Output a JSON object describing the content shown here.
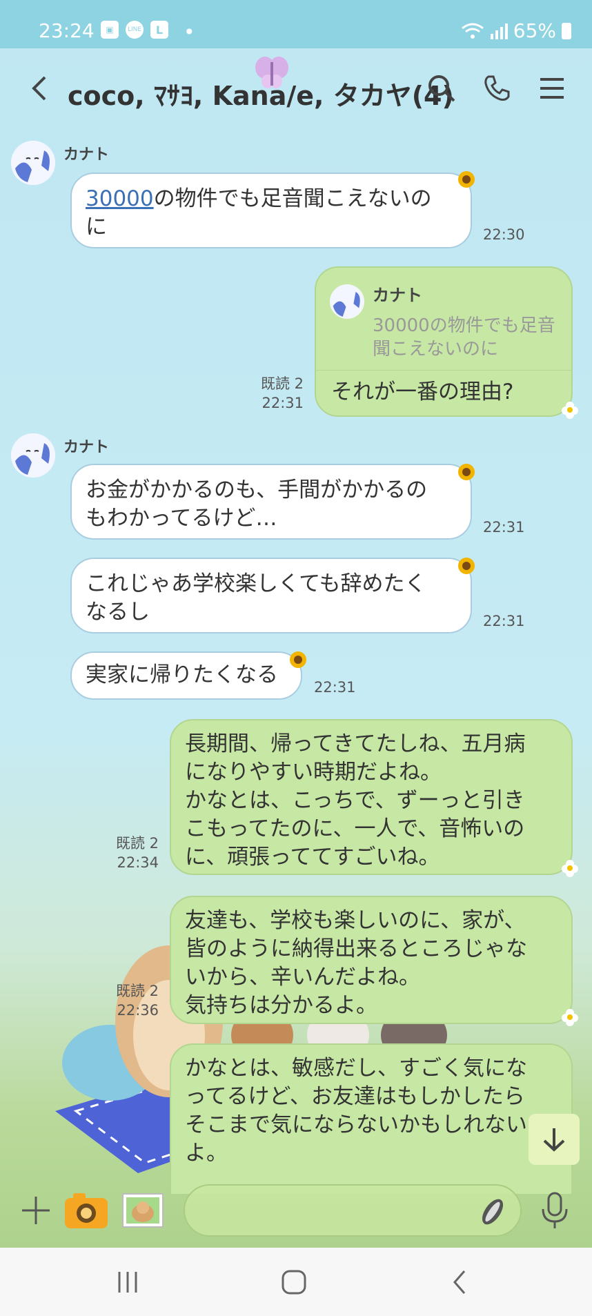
{
  "status": {
    "time": "23:24",
    "battery": "65%",
    "line_icon": "LINE",
    "l_icon": "L"
  },
  "header": {
    "title": "coco, ﾏｻﾖ, Kana/e, タカヤ(4)"
  },
  "messages": [
    {
      "sender": "カナト",
      "link": "30000",
      "text_rest": "の物件でも足音聞こえないの",
      "text2": "に",
      "time": "22:30"
    },
    {
      "quote_name": "カナト",
      "quote_line1": "30000の物件でも足音",
      "quote_line2": "聞こえないのに",
      "text": "それが一番の理由?",
      "read": "既読 2",
      "time": "22:31"
    },
    {
      "sender": "カナト",
      "line1": "お金がかかるのも、手間がかかるの",
      "line2": "もわかってるけど…",
      "time": "22:31"
    },
    {
      "line1": "これじゃあ学校楽しくても辞めたく",
      "line2": "なるし",
      "time": "22:31"
    },
    {
      "text": "実家に帰りたくなる",
      "time": "22:31"
    },
    {
      "lines": [
        "長期間、帰ってきてたしね、五月病",
        "になりやすい時期だよね。",
        "かなとは、こっちで、ずーっと引き",
        "こもってたのに、一人で、音怖いの",
        "に、頑張っててすごいね。"
      ],
      "read": "既読 2",
      "time": "22:34"
    },
    {
      "lines": [
        "友達も、学校も楽しいのに、家が、",
        "皆のように納得出来るところじゃな",
        "いから、辛いんだよね。",
        "気持ちは分かるよ。"
      ],
      "read": "既読 2",
      "time": "22:36"
    },
    {
      "lines": [
        "かなとは、敏感だし、すごく気にな",
        "ってるけど、お友達はもしかしたら",
        "そこまで気にならないかもしれない",
        "よ。"
      ]
    }
  ],
  "icons": {
    "back": "back-arrow-icon",
    "search": "search-icon",
    "call": "phone-icon",
    "menu": "menu-icon",
    "plus": "plus-icon",
    "camera": "camera-icon",
    "gallery": "gallery-icon",
    "attach": "seed-icon",
    "mic": "mic-icon"
  },
  "colors": {
    "header_bg": "#8ed3e2",
    "bubble_mine": "#c7e8a4",
    "bubble_other": "#ffffff",
    "link": "#3b6fb6"
  }
}
